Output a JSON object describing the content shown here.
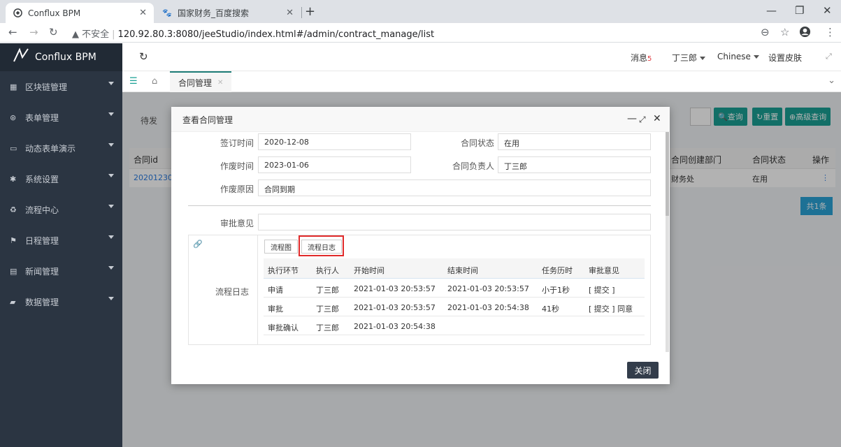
{
  "browser": {
    "tabs": [
      {
        "title": "Conflux BPM",
        "active": true
      },
      {
        "title": "国家财务_百度搜索",
        "active": false
      }
    ],
    "url_warning": "不安全",
    "url": "120.92.80.3:8080/jeeStudio/index.html#/admin/contract_manage/list"
  },
  "app": {
    "logo": "Conflux BPM",
    "sidebar": [
      {
        "label": "区块链管理",
        "icon": "blockchain-icon"
      },
      {
        "label": "表单管理",
        "icon": "form-icon"
      },
      {
        "label": "动态表单演示",
        "icon": "monitor-icon"
      },
      {
        "label": "系统设置",
        "icon": "gear-icon"
      },
      {
        "label": "流程中心",
        "icon": "recycle-icon"
      },
      {
        "label": "日程管理",
        "icon": "flag-icon"
      },
      {
        "label": "新闻管理",
        "icon": "news-icon"
      },
      {
        "label": "数据管理",
        "icon": "database-icon"
      }
    ],
    "topbar": {
      "messages": "消息",
      "message_count": "5",
      "user": "丁三郎",
      "language": "Chinese",
      "skin": "设置皮肤"
    },
    "tab": "合同管理"
  },
  "background": {
    "tab_label": "待发",
    "buttons": [
      "查询",
      "重置",
      "高级查询"
    ],
    "columns": [
      "合同id",
      "合同创建部门",
      "合同状态",
      "操作"
    ],
    "row": {
      "id": "2020123000",
      "dept": "财务处",
      "status": "在用",
      "op": "⋮"
    },
    "total": "共1条"
  },
  "modal": {
    "title": "查看合同管理",
    "fields": {
      "sign_time_label": "签订时间",
      "sign_time": "2020-12-08",
      "status_label": "合同状态",
      "status": "在用",
      "void_time_label": "作废时间",
      "void_time": "2023-01-06",
      "owner_label": "合同负责人",
      "owner": "丁三郎",
      "void_reason_label": "作废原因",
      "void_reason": "合同到期",
      "approval_label": "审批意见",
      "approval": ""
    },
    "log": {
      "label": "流程日志",
      "btn_diagram": "流程图",
      "btn_log": "流程日志",
      "columns": [
        "执行环节",
        "执行人",
        "开始时间",
        "结束时间",
        "任务历时",
        "审批意见"
      ],
      "rows": [
        [
          "申请",
          "丁三郎",
          "2021-01-03 20:53:57",
          "2021-01-03 20:53:57",
          "小于1秒",
          "[ 提交 ]"
        ],
        [
          "审批",
          "丁三郎",
          "2021-01-03 20:53:57",
          "2021-01-03 20:54:38",
          "41秒",
          "[ 提交 ] 同意"
        ],
        [
          "审批确认",
          "丁三郎",
          "2021-01-03 20:54:38",
          "",
          "",
          ""
        ]
      ]
    },
    "close": "关闭"
  }
}
